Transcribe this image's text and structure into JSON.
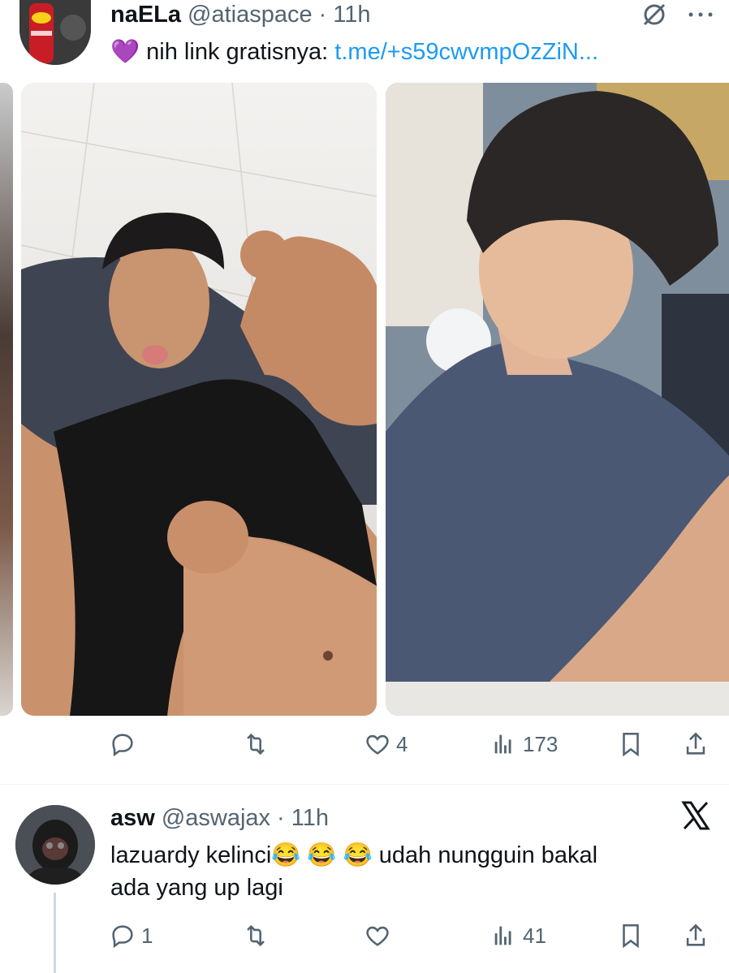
{
  "tweet1": {
    "name": "naELa",
    "handle": "@atiaspace",
    "sep": "·",
    "time": "11h",
    "text": "nih link gratisnya:",
    "link": "t.me/+s59cwvmpOzZiN...",
    "emoji": "💜",
    "avatar_icon": "lays-stax-avatar",
    "media": [
      {
        "alt": "shirtless-man-lifting-shirt-photo"
      },
      {
        "alt": "man-blue-sweater-haircut-photo"
      }
    ],
    "actions": {
      "reply": "",
      "retweet": "",
      "like": "4",
      "views": "173"
    }
  },
  "tweet2": {
    "name": "asw",
    "handle": "@aswajax",
    "sep": "·",
    "time": "11h",
    "text_line1_a": "lazuardy kelinci",
    "emojis": "😂 😂 😂",
    "text_line1_b": "udah nungguin bakal",
    "text_line2": "ada yang up lagi",
    "avatar_icon": "masked-person-avatar",
    "actions": {
      "reply": "1",
      "retweet": "",
      "like": "",
      "views": "41"
    }
  },
  "colors": {
    "accent": "#1d9bf0",
    "muted": "#536471",
    "purple_heart": "#9b59e6"
  }
}
